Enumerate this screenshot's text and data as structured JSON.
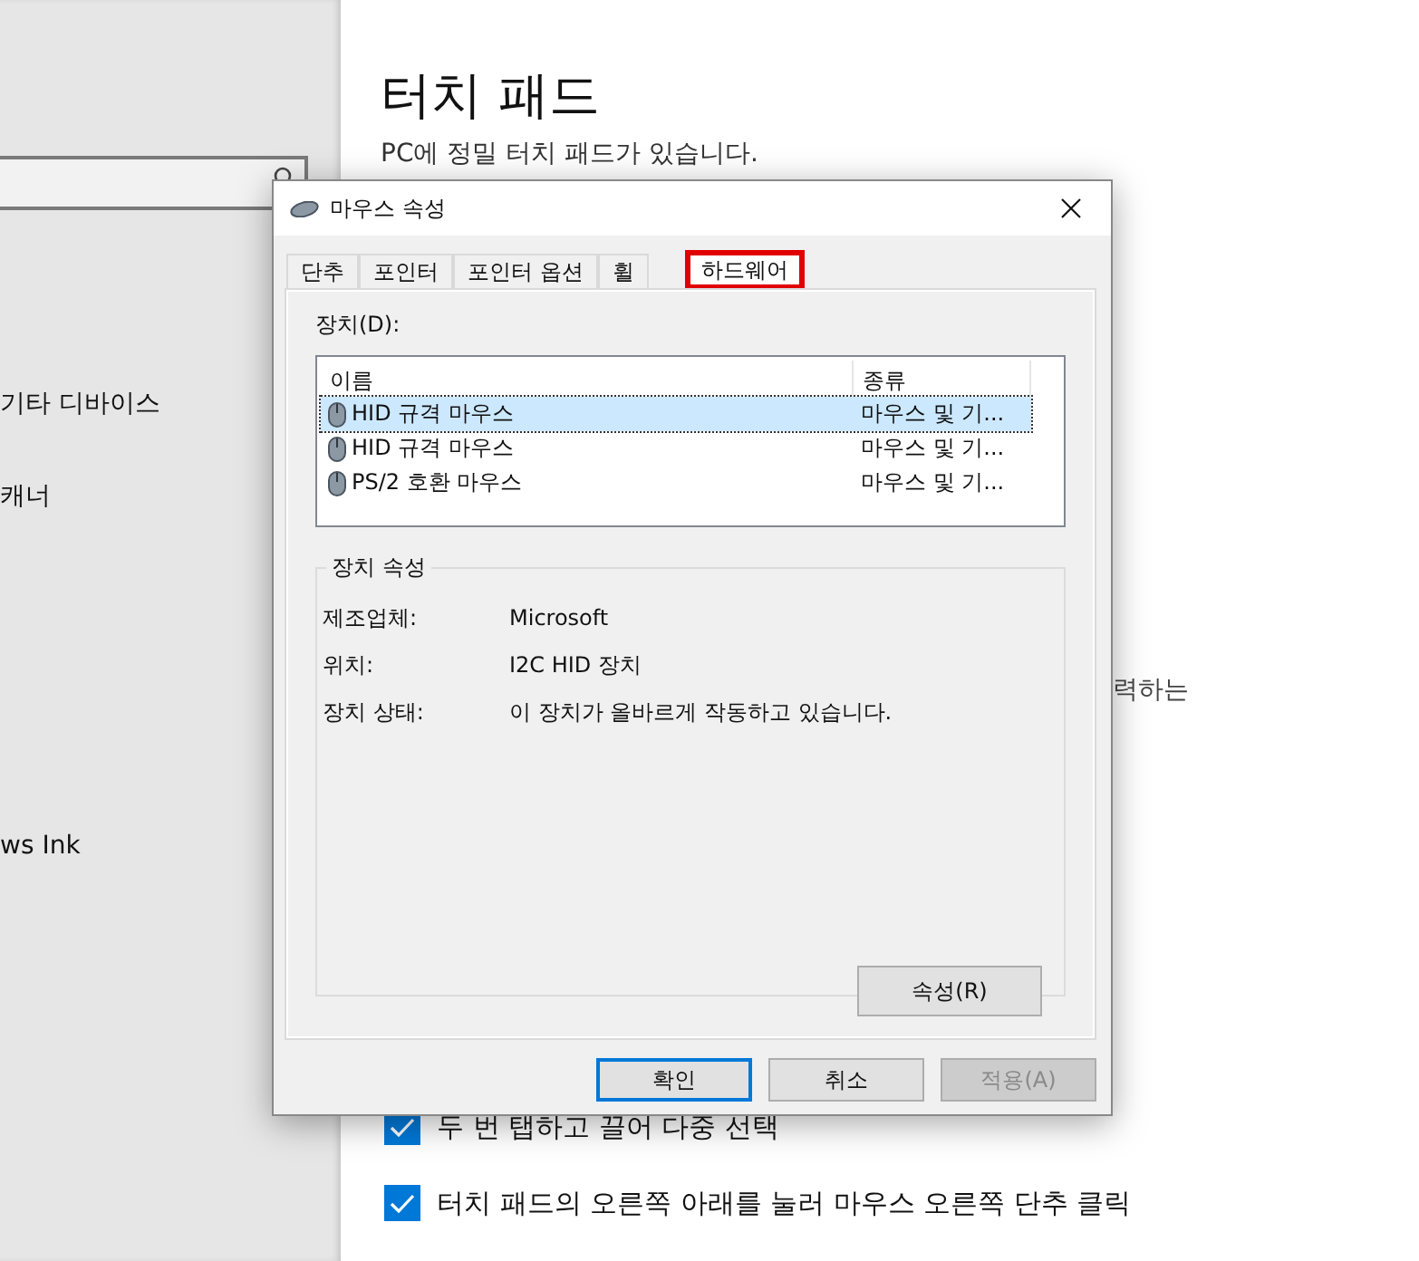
{
  "sidebar": {
    "items": [
      "기타 디바이스",
      "캐너",
      "ws Ink"
    ]
  },
  "page": {
    "title": "터치 패드",
    "intro": "PC에 정밀 터치 패드가 있습니다.",
    "fragment": "력하는",
    "options": [
      {
        "label": "두 번 탭하고 끌어 다중 선택",
        "checked": true
      },
      {
        "label": "터치 패드의 오른쪽 아래를 눌러 마우스 오른쪽 단추 클릭",
        "checked": true
      }
    ]
  },
  "dialog": {
    "title": "마우스 속성",
    "tabs": [
      {
        "label": "단추",
        "selected": false,
        "highlighted": false
      },
      {
        "label": "포인터",
        "selected": false,
        "highlighted": false
      },
      {
        "label": "포인터 옵션",
        "selected": false,
        "highlighted": false
      },
      {
        "label": "휠",
        "selected": false,
        "highlighted": false
      },
      {
        "label": "하드웨어",
        "selected": true,
        "highlighted": true
      }
    ],
    "devices_label": "장치(D):",
    "columns": [
      "이름",
      "종류"
    ],
    "devices": [
      {
        "name": "HID 규격 마우스",
        "type": "마우스 및 기...",
        "selected": true
      },
      {
        "name": "HID 규격 마우스",
        "type": "마우스 및 기...",
        "selected": false
      },
      {
        "name": "PS/2 호환 마우스",
        "type": "마우스 및 기...",
        "selected": false
      }
    ],
    "properties_title": "장치 속성",
    "properties": [
      {
        "label": "제조업체:",
        "value": "Microsoft"
      },
      {
        "label": "위치:",
        "value": "I2C HID 장치"
      },
      {
        "label": "장치 상태:",
        "value": "이 장치가 올바르게 작동하고 있습니다."
      }
    ],
    "properties_button": "속성(R)",
    "buttons": [
      {
        "label": "확인",
        "kind": "default",
        "disabled": false
      },
      {
        "label": "취소",
        "kind": "normal",
        "disabled": false
      },
      {
        "label": "적용(A)",
        "kind": "normal",
        "disabled": true
      }
    ]
  }
}
